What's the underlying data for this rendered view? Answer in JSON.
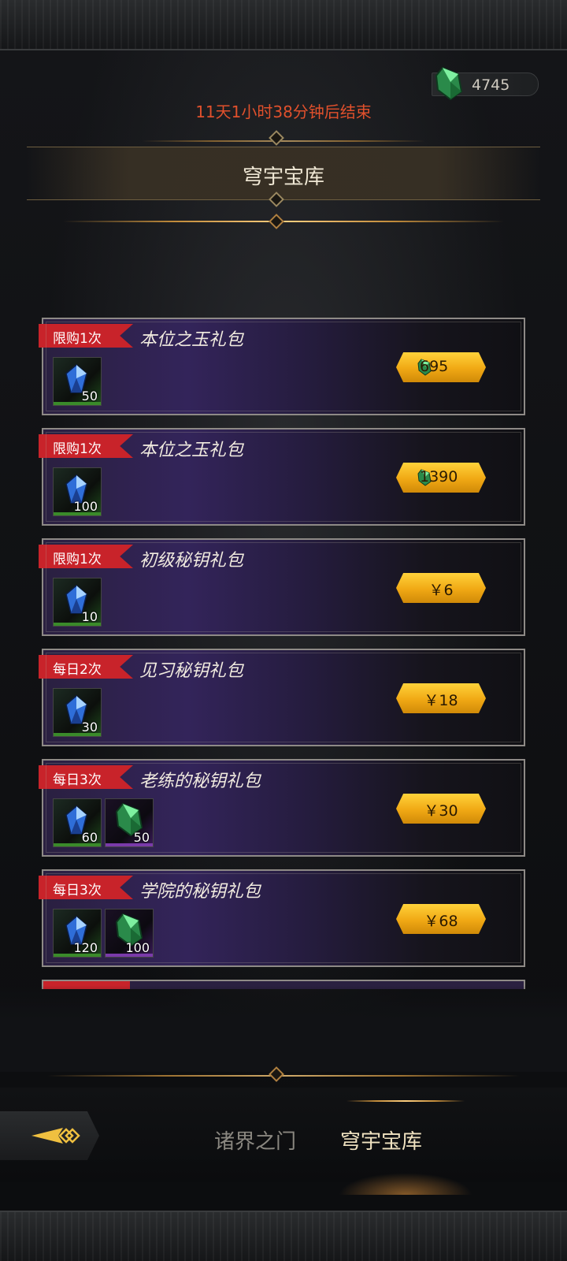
{
  "header": {
    "currency_amount": "4745",
    "countdown": "11天1小时38分钟后结束",
    "title": "穹宇宝库"
  },
  "packs": [
    {
      "limit": "限购1次",
      "title": "本位之玉礼包",
      "items": [
        {
          "icon": "blue-crystal-icon",
          "qty": "50"
        }
      ],
      "price": "695",
      "price_type": "gem"
    },
    {
      "limit": "限购1次",
      "title": "本位之玉礼包",
      "items": [
        {
          "icon": "blue-crystal-icon",
          "qty": "100"
        }
      ],
      "price": "1390",
      "price_type": "gem"
    },
    {
      "limit": "限购1次",
      "title": "初级秘钥礼包",
      "items": [
        {
          "icon": "blue-crystal-icon",
          "qty": "10"
        }
      ],
      "price": "￥6",
      "price_type": "cash"
    },
    {
      "limit": "每日2次",
      "title": "见习秘钥礼包",
      "items": [
        {
          "icon": "blue-crystal-icon",
          "qty": "30"
        }
      ],
      "price": "￥18",
      "price_type": "cash"
    },
    {
      "limit": "每日3次",
      "title": "老练的秘钥礼包",
      "items": [
        {
          "icon": "blue-crystal-icon",
          "qty": "60"
        },
        {
          "icon": "green-gem-icon",
          "qty": "50"
        }
      ],
      "price": "￥30",
      "price_type": "cash"
    },
    {
      "limit": "每日3次",
      "title": "学院的秘钥礼包",
      "items": [
        {
          "icon": "blue-crystal-icon",
          "qty": "120"
        },
        {
          "icon": "green-gem-icon",
          "qty": "100"
        }
      ],
      "price": "￥68",
      "price_type": "cash"
    }
  ],
  "tabs": [
    {
      "label": "诸界之门",
      "active": false
    },
    {
      "label": "穹宇宝库",
      "active": true
    }
  ],
  "colors": {
    "accent_gold": "#f0a814",
    "ribbon_red": "#c8232a",
    "countdown_red": "#e0502c"
  }
}
